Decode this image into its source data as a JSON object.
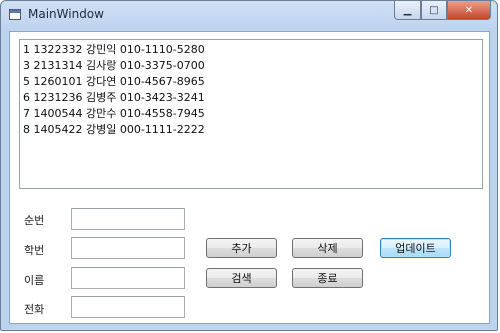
{
  "window": {
    "title": "MainWindow",
    "minimize_glyph": "▁",
    "maximize_glyph": "□",
    "close_glyph": "✕"
  },
  "list": {
    "items": [
      "1 1322332 강민익 010-1110-5280",
      "3 2131314 김사랑 010-3375-0700",
      "5 1260101 강다연 010-4567-8965",
      "6 1231236 김병주 010-3423-3241",
      "7 1400544 강만수 010-4558-7945",
      "8 1405422 강병일 000-1111-2222"
    ]
  },
  "form": {
    "number_label": "순번",
    "number_value": "",
    "student_id_label": "학번",
    "student_id_value": "",
    "name_label": "이름",
    "name_value": "",
    "phone_label": "전화",
    "phone_value": ""
  },
  "buttons": {
    "add": "추가",
    "delete": "삭제",
    "update": "업데이트",
    "search": "검색",
    "exit": "종료"
  },
  "colors": {
    "frame": "#bcd3ee",
    "close_button": "#c6452c",
    "focus_border": "#3c7fb1"
  }
}
